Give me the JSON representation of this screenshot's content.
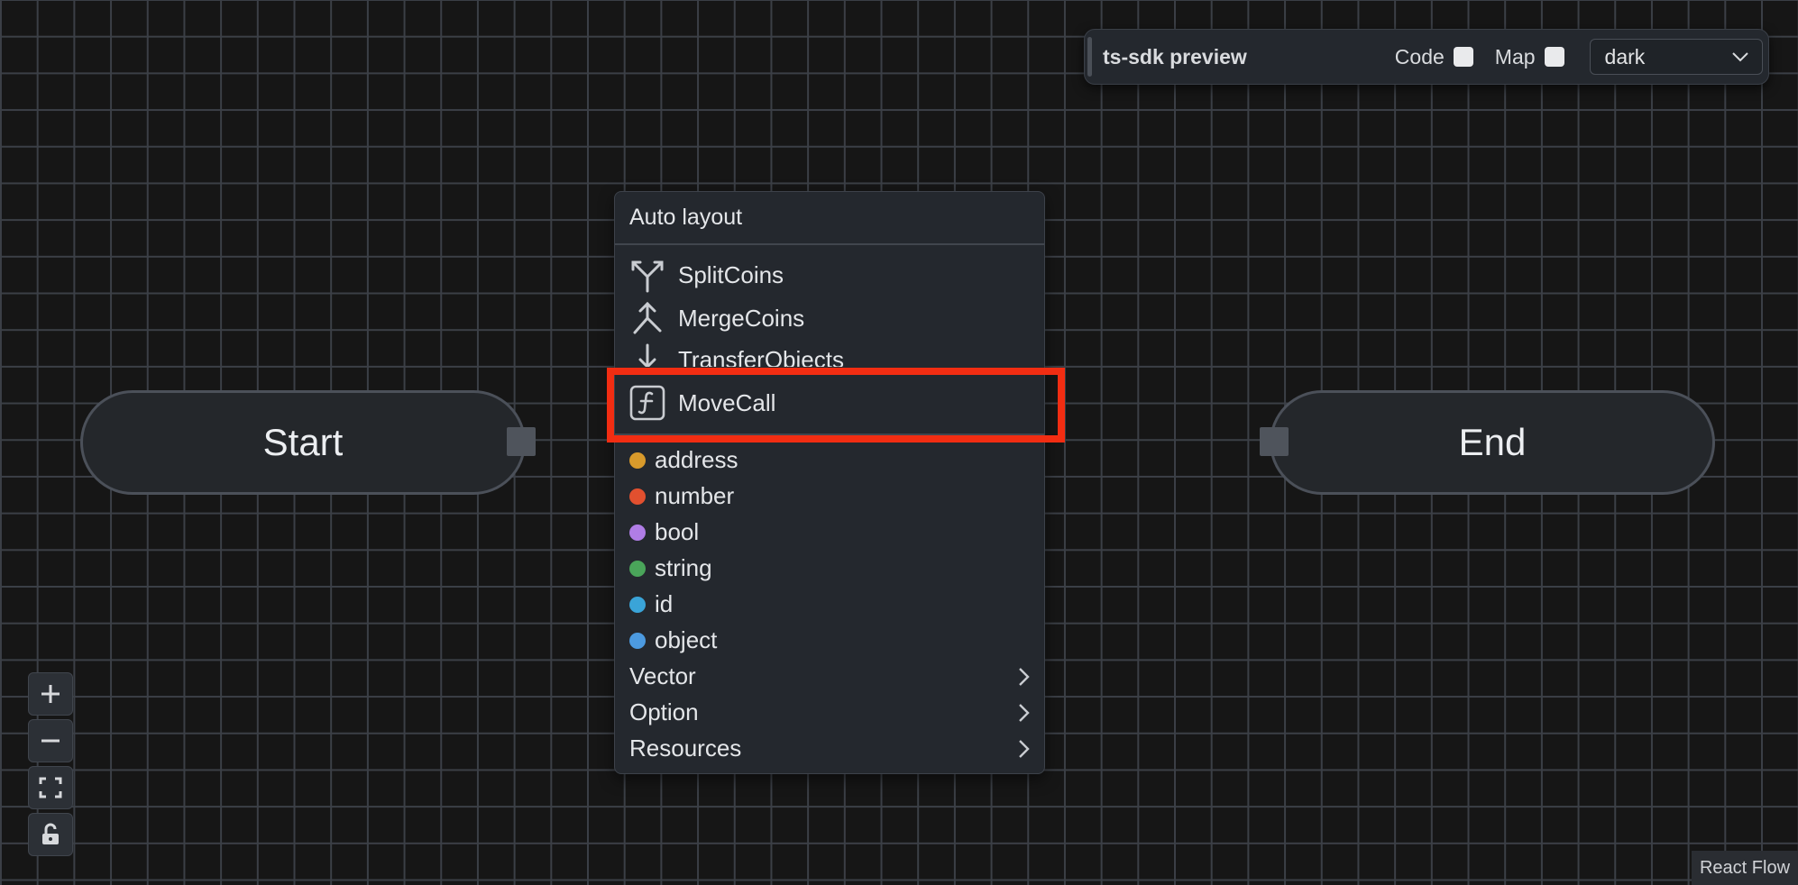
{
  "toolbar": {
    "title": "ts-sdk preview",
    "code_label": "Code",
    "map_label": "Map",
    "theme_select": {
      "value": "dark"
    }
  },
  "nodes": {
    "start": {
      "label": "Start"
    },
    "end": {
      "label": "End"
    }
  },
  "context_menu": {
    "header": "Auto layout",
    "commands": [
      {
        "label": "SplitCoins",
        "icon": "split-coins-icon"
      },
      {
        "label": "MergeCoins",
        "icon": "merge-coins-icon"
      },
      {
        "label": "TransferObjects",
        "icon": "transfer-objects-icon"
      },
      {
        "label": "MoveCall",
        "icon": "function-icon"
      }
    ],
    "types": [
      {
        "label": "address",
        "color": "#d89a2b"
      },
      {
        "label": "number",
        "color": "#e2502f"
      },
      {
        "label": "bool",
        "color": "#b07de6"
      },
      {
        "label": "string",
        "color": "#4aa55a"
      },
      {
        "label": "id",
        "color": "#3aa4d8"
      },
      {
        "label": "object",
        "color": "#4c9ae0"
      }
    ],
    "submenus": [
      {
        "label": "Vector"
      },
      {
        "label": "Option"
      },
      {
        "label": "Resources"
      }
    ]
  },
  "highlight_color": "#f22d12",
  "controls": {
    "zoom_in": "plus-icon",
    "zoom_out": "minus-icon",
    "fit_view": "fit-view-icon",
    "lock": "unlock-icon"
  },
  "attribution": "React Flow"
}
